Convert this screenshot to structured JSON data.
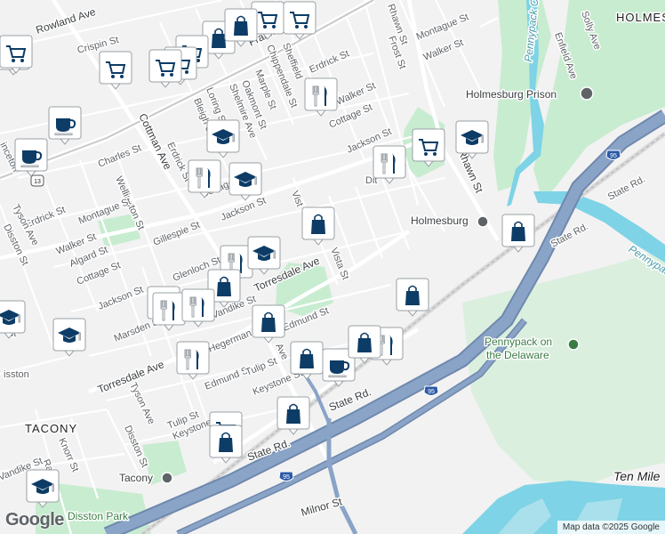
{
  "map": {
    "colors": {
      "background": "#f2f2f2",
      "park": "#c8ecd0",
      "water": "#7ed3e6",
      "highway": "#8aa4c8",
      "highway_edge": "#6f88ad",
      "road": "#ffffff",
      "pin_icon": "#0d3c66"
    },
    "labels": {
      "rowland": "Rowland Ave",
      "frankford": "Frankford Ave",
      "crispin": "Crispin St",
      "rhawn_top": "Rhawn St",
      "montague_top": "Montague St",
      "walker_top": "Walker St",
      "frost": "Frost St",
      "enfield": "Enfield Ave",
      "solly": "Solly Ave",
      "holmesburg_top": "HOLMES",
      "erdrick_top": "Erdrick St",
      "walker_mid": "Walker St",
      "cottage_top": "Cottage St",
      "jackson_top": "Jackson St",
      "holmesburg_prison": "Holmesburg Prison",
      "sheffield": "Sheffield",
      "chippendale": "Chippendale St",
      "marple": "Marple St",
      "oakmont": "Oakmont St",
      "shelmire": "Shelmire Ave",
      "loring": "Loring St",
      "bleigh": "Bleigh St",
      "cottman": "Cottman Ave",
      "erdrick_mid": "Erdrick St",
      "charles": "Charles St",
      "wellington": "Wellington St",
      "montague_left": "Montague St",
      "erdrick_left": "Erdrick St",
      "tyson_left": "Tyson Ave",
      "walker_left": "Walker St",
      "algard": "Algard St",
      "cottage_left": "Cottage St",
      "gillespie": "Gillespie St",
      "jackson_mid": "Jackson St",
      "cottage_mid": "Cottage",
      "vista_top": "Vist",
      "vista": "Vista St",
      "dit": "Dit",
      "rhawn_mid": "Rhawn St",
      "holmesburg_station": "Holmesburg",
      "state_rd_right": "State Rd.",
      "state_rd_far": "State Rd.",
      "pennypack_ck": "Pennypack",
      "pennypack_creek_top": "Pennypack Creek",
      "torresdale_mid": "Torresdale Ave",
      "glenloch": "Glenloch St",
      "jackson_left": "Jackson St",
      "marsden": "Marsden St",
      "vandike": "Vandike St",
      "edmund_mid": "Edmund St",
      "hegerman": "Hegerman St",
      "torresdale_left": "Torresdale Ave",
      "tyson_low": "Tyson Ave",
      "edmund_low": "Edmund St",
      "tulip_mid": "Tulip St",
      "keystone_mid": "Keystone St",
      "tulip_low": "Tulip St",
      "state_rd_mid": "State Rd.",
      "state_rd_low": "State Rd.",
      "pennypack_park_1": "Pennypack on",
      "pennypack_park_2": "the Delaware",
      "tacony": "TACONY",
      "knorr": "Knorr St",
      "disston": "Disston St",
      "disston_left": "Disston St",
      "ra": "Ra",
      "vandike_left": "Vandike St",
      "keystone_low": "Keystone",
      "tacony_station": "Tacony",
      "milnor": "Milnor St",
      "disston_park": "Disston Park",
      "ten_mile": "Ten Mile",
      "i95_a": "95",
      "i95_b": "95",
      "i95_c": "95",
      "route_13": "13",
      "st_low": "St",
      "inceton": "inceton",
      "isston": "isston",
      "ave_v": "Ave"
    },
    "pins": [
      {
        "type": "shopping-cart"
      },
      {
        "type": "shopping-bag"
      },
      {
        "type": "shopping-cart"
      },
      {
        "type": "shopping-cart"
      },
      {
        "type": "shopping-bag"
      },
      {
        "type": "shopping-cart"
      },
      {
        "type": "shopping-cart"
      },
      {
        "type": "shopping-cart"
      },
      {
        "type": "shopping-cart"
      },
      {
        "type": "shopping-cart"
      },
      {
        "type": "cafe"
      },
      {
        "type": "cafe"
      },
      {
        "type": "restaurant"
      },
      {
        "type": "school"
      },
      {
        "type": "restaurant"
      },
      {
        "type": "school"
      },
      {
        "type": "shopping-cart"
      },
      {
        "type": "school"
      },
      {
        "type": "restaurant"
      },
      {
        "type": "shopping-bag"
      },
      {
        "type": "shopping-bag"
      },
      {
        "type": "restaurant"
      },
      {
        "type": "school"
      },
      {
        "type": "shopping-bag"
      },
      {
        "type": "restaurant"
      },
      {
        "type": "restaurant"
      },
      {
        "type": "shopping-bag"
      },
      {
        "type": "school"
      },
      {
        "type": "school"
      },
      {
        "type": "shopping-bag"
      },
      {
        "type": "restaurant"
      },
      {
        "type": "restaurant"
      },
      {
        "type": "shopping-bag"
      },
      {
        "type": "shopping-bag"
      },
      {
        "type": "cafe"
      },
      {
        "type": "restaurant"
      },
      {
        "type": "shopping-bag"
      },
      {
        "type": "shopping-cart"
      },
      {
        "type": "shopping-bag"
      },
      {
        "type": "school"
      }
    ],
    "logo": "Google",
    "attribution": "Map data ©2025 Google"
  }
}
